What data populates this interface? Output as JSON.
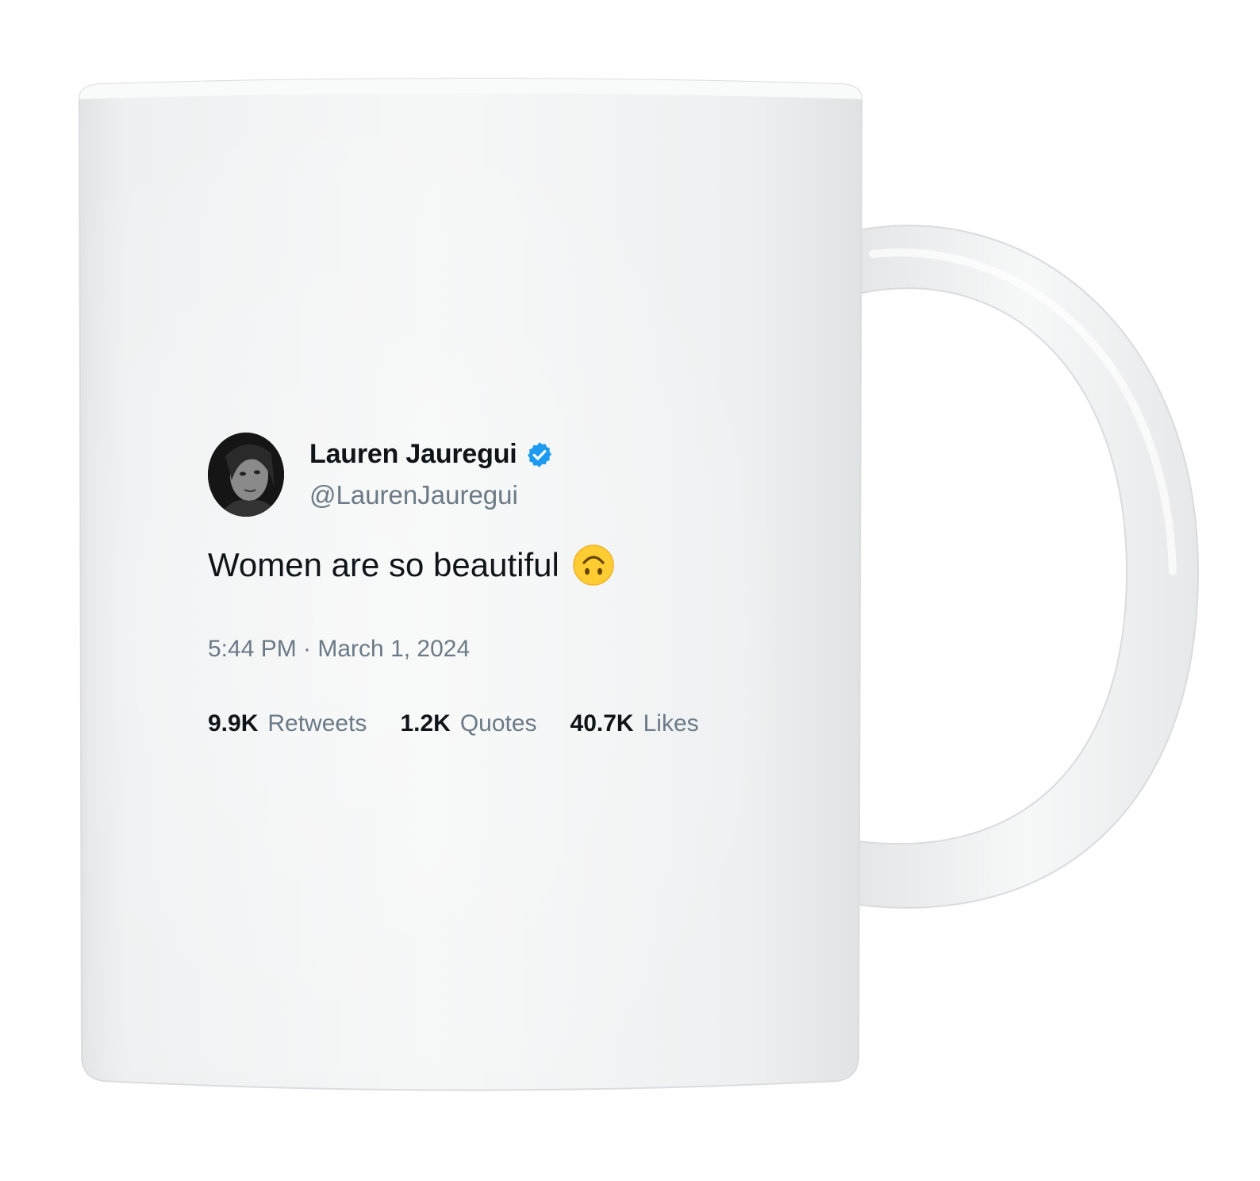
{
  "tweet": {
    "display_name": "Lauren Jauregui",
    "handle": "@LaurenJauregui",
    "verified_icon": "verified-badge-icon",
    "text": "Women are so beautiful",
    "emoji": "upside-down-face-emoji",
    "timestamp": "5:44 PM · March 1, 2024",
    "stats": [
      {
        "value": "9.9K",
        "label": "Retweets"
      },
      {
        "value": "1.2K",
        "label": "Quotes"
      },
      {
        "value": "40.7K",
        "label": "Likes"
      }
    ]
  },
  "colors": {
    "verified_blue": "#1d9bf0",
    "emoji_yellow": "#ffcc33",
    "muted_text": "#6b7a86",
    "mug_white": "#f2f3f4"
  }
}
